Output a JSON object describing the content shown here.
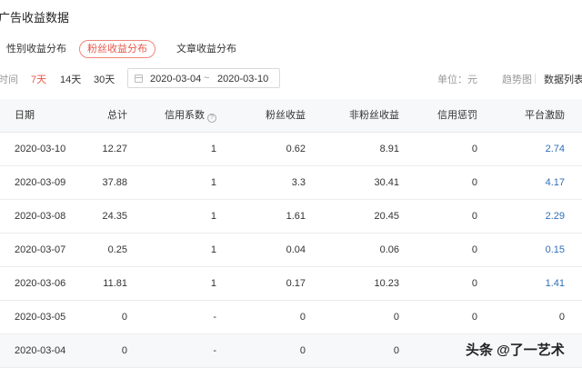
{
  "page": {
    "title": "广告收益数据"
  },
  "tabs": [
    {
      "label": "性别收益分布",
      "active": false
    },
    {
      "label": "粉丝收益分布",
      "active": true
    },
    {
      "label": "文章收益分布",
      "active": false
    }
  ],
  "filters": {
    "time_label": "时间",
    "ranges": [
      {
        "label": "7天",
        "active": true
      },
      {
        "label": "14天",
        "active": false
      },
      {
        "label": "30天",
        "active": false
      }
    ],
    "date_start": "2020-03-04",
    "date_separator": "~",
    "date_end": "2020-03-10",
    "unit": "单位：元",
    "view_chart": "趋势图",
    "view_table": "数据列表"
  },
  "table": {
    "headers": [
      "日期",
      "总计",
      "信用系数",
      "粉丝收益",
      "非粉丝收益",
      "信用惩罚",
      "平台激励"
    ],
    "help_icon": "?",
    "rows": [
      [
        "2020-03-10",
        "12.27",
        "1",
        "0.62",
        "8.91",
        "0",
        "2.74"
      ],
      [
        "2020-03-09",
        "37.88",
        "1",
        "3.3",
        "30.41",
        "0",
        "4.17"
      ],
      [
        "2020-03-08",
        "24.35",
        "1",
        "1.61",
        "20.45",
        "0",
        "2.29"
      ],
      [
        "2020-03-07",
        "0.25",
        "1",
        "0.04",
        "0.06",
        "0",
        "0.15"
      ],
      [
        "2020-03-06",
        "11.81",
        "1",
        "0.17",
        "10.23",
        "0",
        "1.41"
      ],
      [
        "2020-03-05",
        "0",
        "-",
        "0",
        "0",
        "0",
        "0"
      ],
      [
        "2020-03-04",
        "0",
        "-",
        "0",
        "0",
        "",
        ""
      ]
    ]
  },
  "watermark": "头条 @了一艺术",
  "colors": {
    "accent": "#e8574a",
    "link": "#2f6fb7",
    "header_bg": "#f7f8fa"
  }
}
